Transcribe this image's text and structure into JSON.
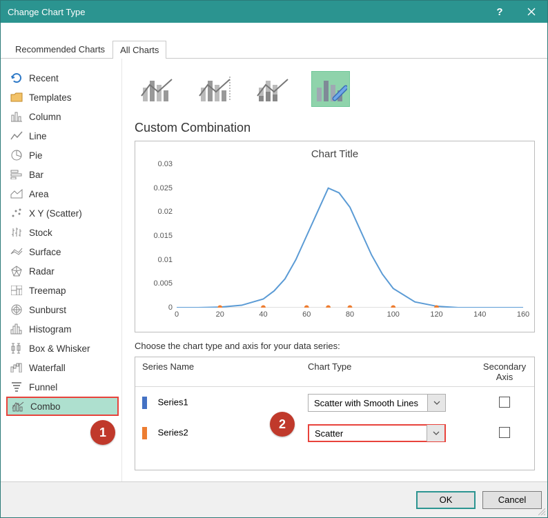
{
  "window": {
    "title": "Change Chart Type"
  },
  "tabs": {
    "recommended": "Recommended Charts",
    "all": "All Charts"
  },
  "sidebar": {
    "items": [
      {
        "id": "recent",
        "label": "Recent"
      },
      {
        "id": "templates",
        "label": "Templates"
      },
      {
        "id": "column",
        "label": "Column"
      },
      {
        "id": "line",
        "label": "Line"
      },
      {
        "id": "pie",
        "label": "Pie"
      },
      {
        "id": "bar",
        "label": "Bar"
      },
      {
        "id": "area",
        "label": "Area"
      },
      {
        "id": "scatter",
        "label": "X Y (Scatter)"
      },
      {
        "id": "stock",
        "label": "Stock"
      },
      {
        "id": "surface",
        "label": "Surface"
      },
      {
        "id": "radar",
        "label": "Radar"
      },
      {
        "id": "treemap",
        "label": "Treemap"
      },
      {
        "id": "sunburst",
        "label": "Sunburst"
      },
      {
        "id": "histogram",
        "label": "Histogram"
      },
      {
        "id": "box",
        "label": "Box & Whisker"
      },
      {
        "id": "waterfall",
        "label": "Waterfall"
      },
      {
        "id": "funnel",
        "label": "Funnel"
      },
      {
        "id": "combo",
        "label": "Combo"
      }
    ]
  },
  "main": {
    "heading": "Custom Combination",
    "chart_title": "Chart Title",
    "choose_label": "Choose the chart type and axis for your data series:",
    "columns": {
      "name": "Series Name",
      "type": "Chart Type",
      "secondary": "Secondary Axis"
    },
    "series": [
      {
        "name": "Series1",
        "color": "#4472c4",
        "type": "Scatter with Smooth Lines",
        "secondary": false
      },
      {
        "name": "Series2",
        "color": "#ed7d31",
        "type": "Scatter",
        "secondary": false
      }
    ]
  },
  "footer": {
    "ok": "OK",
    "cancel": "Cancel"
  },
  "annotations": {
    "one": "1",
    "two": "2"
  },
  "chart_data": {
    "type": "line+scatter",
    "title": "Chart Title",
    "xlabel": "",
    "ylabel": "",
    "xlim": [
      0,
      160
    ],
    "ylim": [
      0,
      0.03
    ],
    "xticks": [
      0,
      20,
      40,
      60,
      80,
      100,
      120,
      140,
      160
    ],
    "yticks": [
      0,
      0.005,
      0.01,
      0.015,
      0.02,
      0.025,
      0.03
    ],
    "series": [
      {
        "name": "Series1",
        "kind": "line-smooth",
        "color": "#5b9bd5",
        "x": [
          0,
          10,
          20,
          30,
          40,
          45,
          50,
          55,
          60,
          65,
          70,
          75,
          80,
          85,
          90,
          95,
          100,
          110,
          120,
          130,
          140,
          150,
          160
        ],
        "y": [
          0,
          0,
          0.0001,
          0.0005,
          0.0018,
          0.0035,
          0.006,
          0.01,
          0.015,
          0.02,
          0.025,
          0.024,
          0.021,
          0.016,
          0.011,
          0.007,
          0.004,
          0.0012,
          0.0003,
          0,
          0,
          0,
          0
        ]
      },
      {
        "name": "Series2",
        "kind": "scatter",
        "color": "#ed7d31",
        "x": [
          20,
          40,
          60,
          70,
          80,
          100,
          120
        ],
        "y": [
          0,
          0,
          0,
          0,
          0,
          0,
          0
        ]
      }
    ]
  }
}
